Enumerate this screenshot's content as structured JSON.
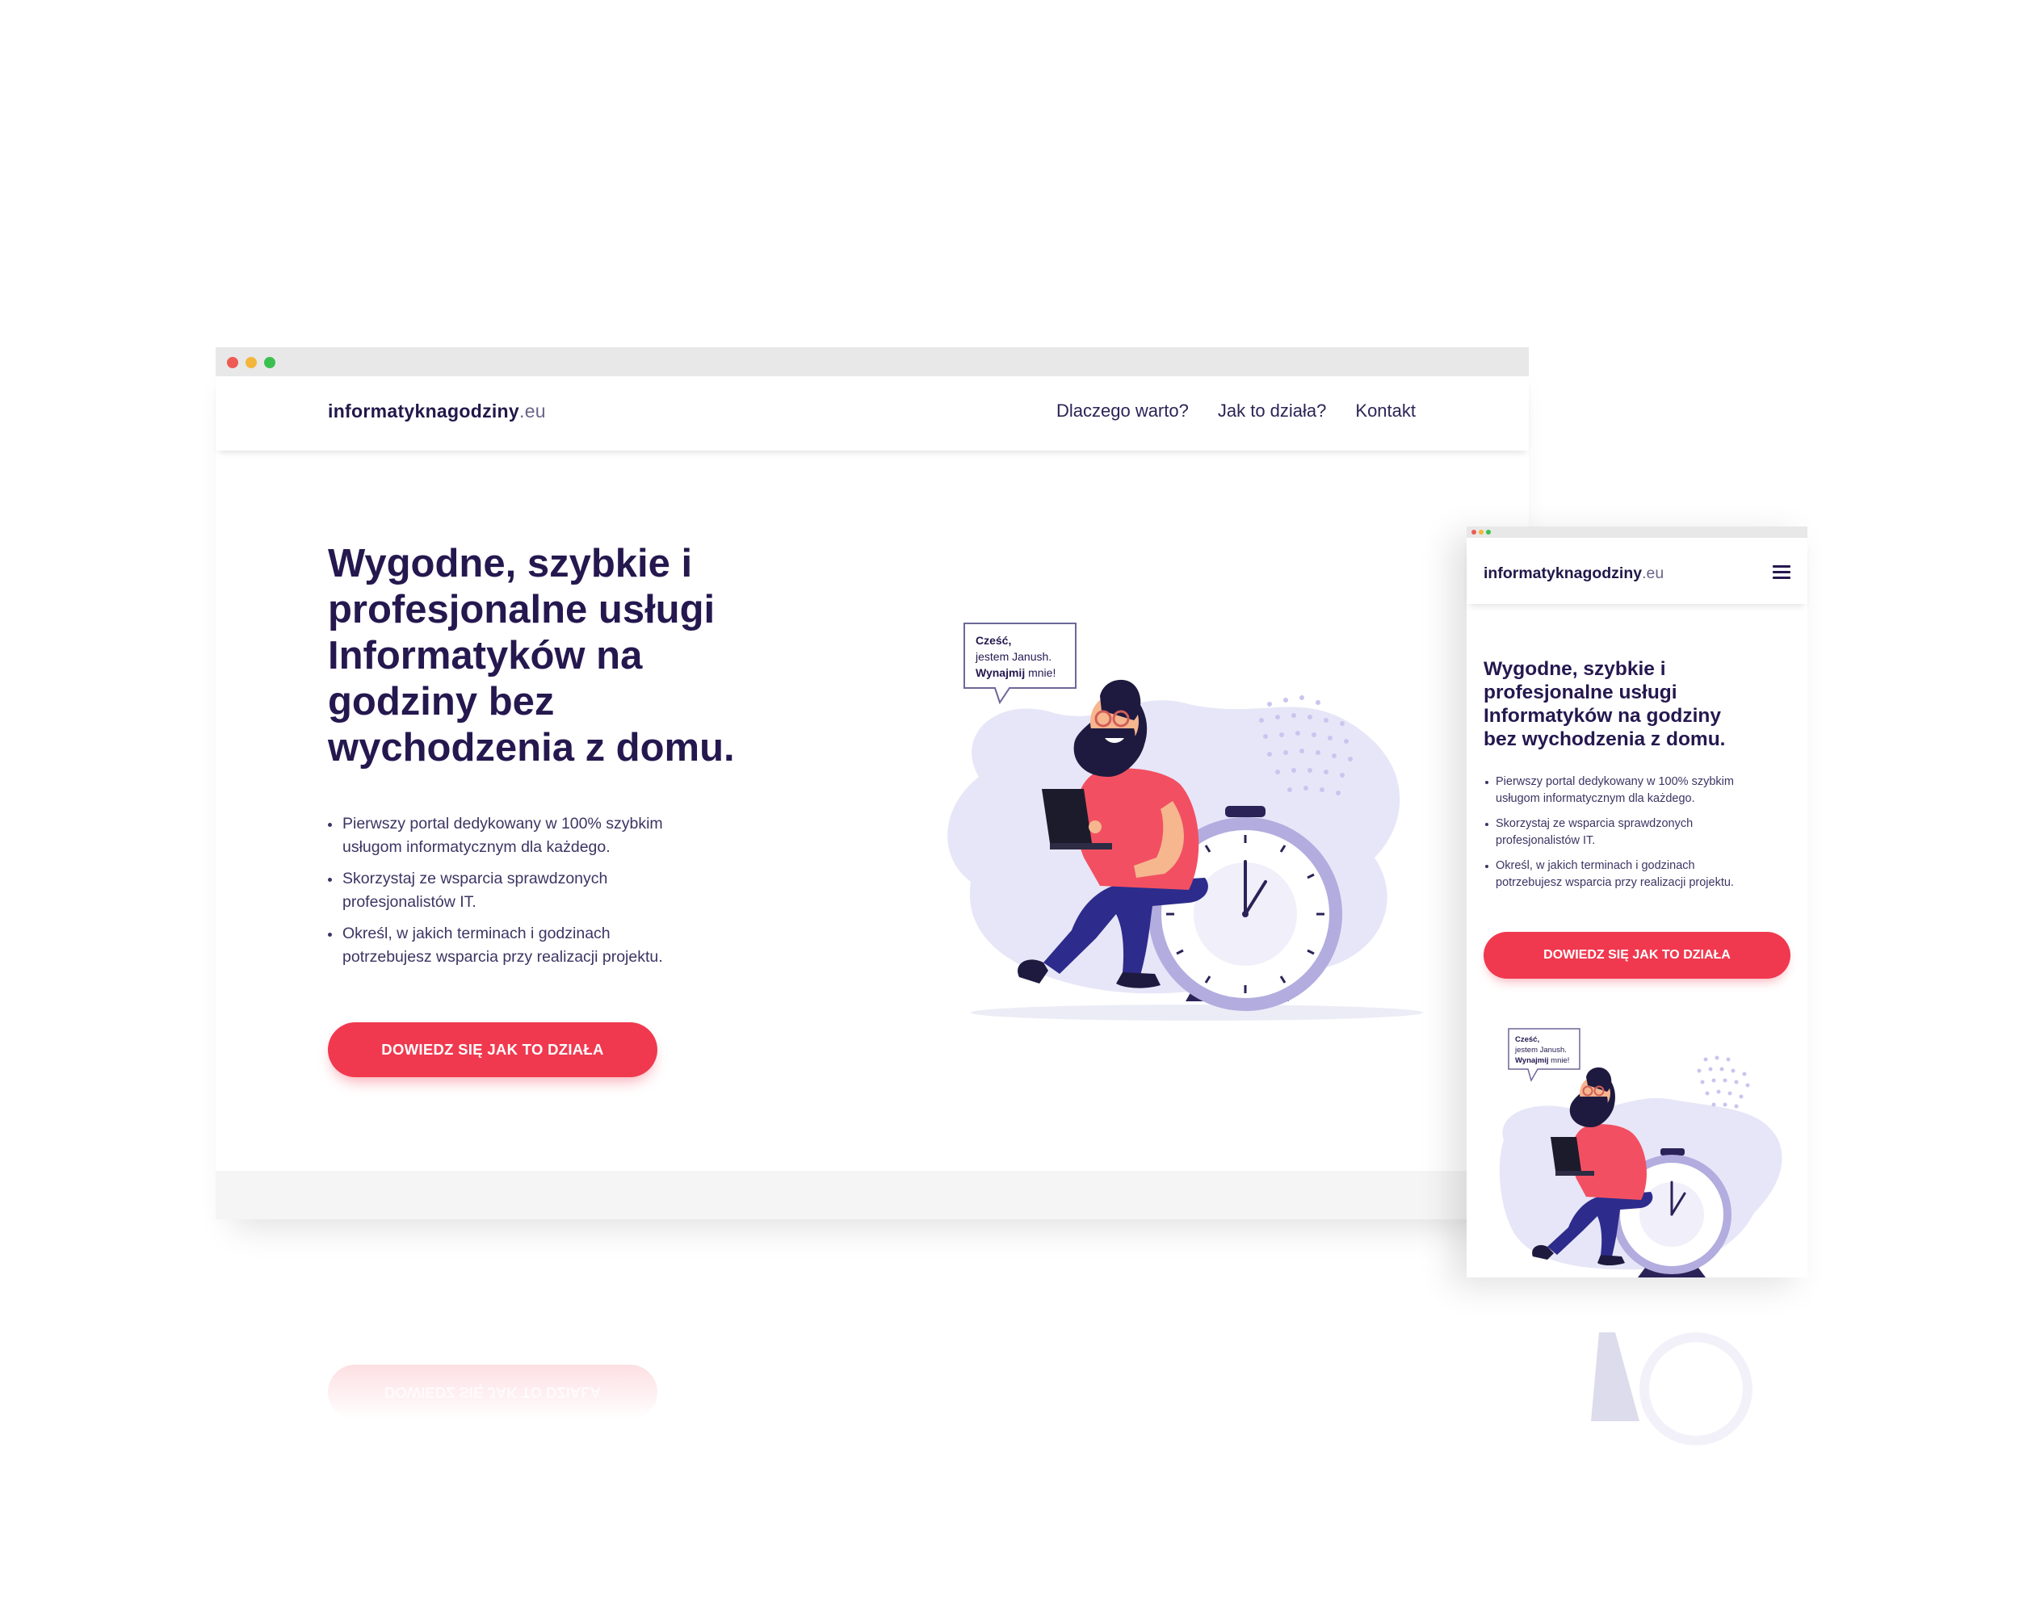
{
  "logo": {
    "bold": "informatyknagodziny",
    "suffix": ".eu"
  },
  "nav": [
    {
      "label": "Dlaczego warto?"
    },
    {
      "label": "Jak to działa?"
    },
    {
      "label": "Kontakt"
    }
  ],
  "hero": {
    "title_desktop_lines": [
      "Wygodne, szybkie i",
      "profesjonalne usługi",
      "Informatyków na",
      "godziny bez",
      "wychodzenia z domu."
    ],
    "title_mobile_lines": [
      "Wygodne, szybkie i",
      "profesjonalne usługi",
      "Informatyków na godziny",
      "bez wychodzenia z domu."
    ],
    "bullets_desktop": [
      {
        "line1": "Pierwszy portal dedykowany w 100% szybkim",
        "line2": "usługom informatycznym dla każdego."
      },
      {
        "line1": "Skorzystaj ze wsparcia sprawdzonych",
        "line2": "profesjonalistów IT."
      },
      {
        "line1": "Określ, w jakich terminach i godzinach",
        "line2": "potrzebujesz wsparcia przy realizacji projektu."
      }
    ],
    "bullets_mobile": [
      {
        "line1": "Pierwszy portal dedykowany w 100% szybkim",
        "line2": "usługom informatycznym dla każdego."
      },
      {
        "line1": "Skorzystaj ze wsparcia sprawdzonych",
        "line2": "profesjonalistów IT."
      },
      {
        "line1": "Określ, w jakich terminach i godzinach",
        "line2": "potrzebujesz wsparcia przy realizacji projektu."
      }
    ],
    "cta": "DOWIEDZ SIĘ JAK TO DZIAŁA"
  },
  "speech_bubble": {
    "line1": "Cześć,",
    "line2": "jestem Janush.",
    "line3_bold": "Wynajmij",
    "line3_rest": " mnie!"
  },
  "colors": {
    "primary": "#25184f",
    "accent": "#f0394f",
    "blob": "#e7e6f8",
    "clock": "#8e86c7"
  },
  "icons": {
    "menu": "hamburger-menu-icon"
  }
}
